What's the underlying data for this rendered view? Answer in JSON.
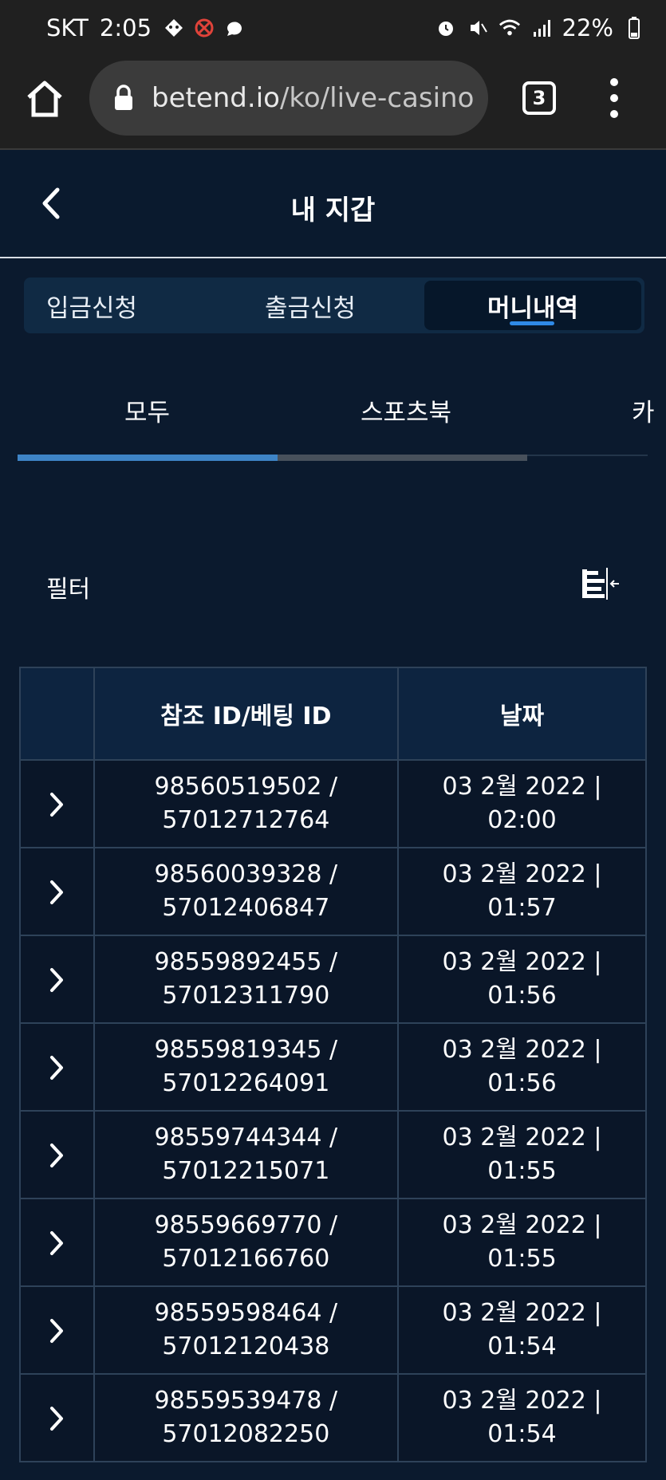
{
  "status_bar": {
    "carrier": "SKT",
    "time": "2:05",
    "battery": "22%"
  },
  "browser": {
    "url_domain": "betend.io",
    "url_path": "/ko/live-casino",
    "tab_count": "3"
  },
  "header": {
    "title": "내 지갑"
  },
  "main_tabs": [
    {
      "label": "입금신청"
    },
    {
      "label": "출금신청"
    },
    {
      "label": "머니내역"
    }
  ],
  "sub_tabs": [
    {
      "label": "모두"
    },
    {
      "label": "스포츠북"
    },
    {
      "label": "카"
    }
  ],
  "filter": {
    "label": "필터"
  },
  "table": {
    "headers": [
      "",
      "참조 ID/베팅 ID",
      "날짜"
    ],
    "rows": [
      {
        "ref": "98560519502 /",
        "bet": "57012712764",
        "date": "03 2월 2022 |",
        "time": "02:00"
      },
      {
        "ref": "98560039328 /",
        "bet": "57012406847",
        "date": "03 2월 2022 |",
        "time": "01:57"
      },
      {
        "ref": "98559892455 /",
        "bet": "57012311790",
        "date": "03 2월 2022 |",
        "time": "01:56"
      },
      {
        "ref": "98559819345 /",
        "bet": "57012264091",
        "date": "03 2월 2022 |",
        "time": "01:56"
      },
      {
        "ref": "98559744344 /",
        "bet": "57012215071",
        "date": "03 2월 2022 |",
        "time": "01:55"
      },
      {
        "ref": "98559669770 /",
        "bet": "57012166760",
        "date": "03 2월 2022 |",
        "time": "01:55"
      },
      {
        "ref": "98559598464 /",
        "bet": "57012120438",
        "date": "03 2월 2022 |",
        "time": "01:54"
      },
      {
        "ref": "98559539478 /",
        "bet": "57012082250",
        "date": "03 2월 2022 |",
        "time": "01:54"
      }
    ]
  },
  "colors": {
    "background": "#0b1a2e",
    "accent": "#2f8ae6",
    "tab_bar": "#102a44"
  },
  "icons": [
    "home-icon",
    "lock-icon",
    "tabs-icon",
    "more-vert-icon",
    "back-icon",
    "filter-icon",
    "chevron-right-icon"
  ]
}
